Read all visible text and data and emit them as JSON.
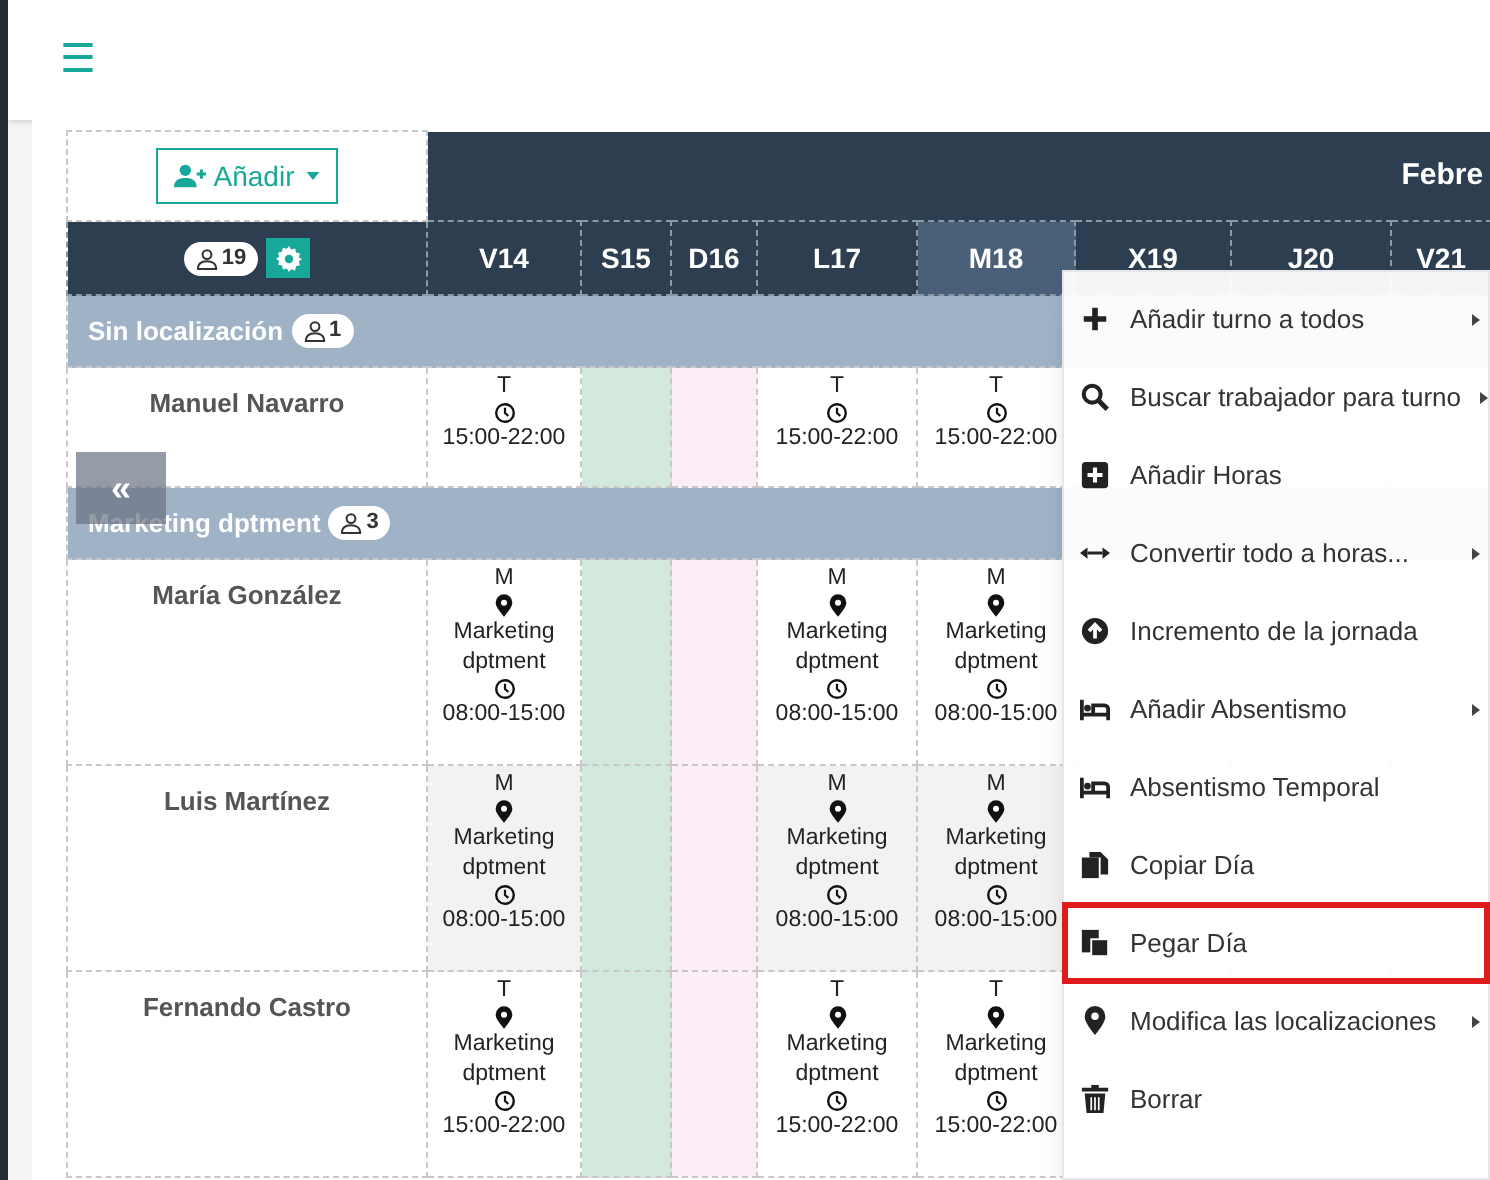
{
  "toolbar": {
    "menu_icon": "☰"
  },
  "planner": {
    "add_button": "Añadir",
    "month": "Febre",
    "staff_count": "19",
    "days": [
      {
        "label": "V14",
        "kind": "weekday",
        "selected": false
      },
      {
        "label": "S15",
        "kind": "saturday",
        "selected": false
      },
      {
        "label": "D16",
        "kind": "sunday",
        "selected": false
      },
      {
        "label": "L17",
        "kind": "weekday",
        "selected": false
      },
      {
        "label": "M18",
        "kind": "weekday",
        "selected": true
      },
      {
        "label": "X19",
        "kind": "weekday",
        "selected": false
      },
      {
        "label": "J20",
        "kind": "weekday",
        "selected": false
      },
      {
        "label": "V21",
        "kind": "weekday",
        "selected": false
      }
    ],
    "groups": [
      {
        "name": "Sin localización",
        "count": "1",
        "employees": [
          {
            "name": "Manuel Navarro",
            "shaded": false,
            "shifts": [
              {
                "kind": "shift",
                "code": "T",
                "time": "15:00-22:00"
              },
              {
                "kind": "empty"
              },
              {
                "kind": "empty"
              },
              {
                "kind": "shift",
                "code": "T",
                "time": "15:00-22:00"
              },
              {
                "kind": "shift",
                "code": "T",
                "time": "15:00-22:00"
              }
            ]
          }
        ]
      },
      {
        "name": "Marketing dptment",
        "count": "3",
        "employees": [
          {
            "name": "María González",
            "shaded": false,
            "shifts": [
              {
                "kind": "shift",
                "code": "M",
                "location": "Marketing dptment",
                "time": "08:00-15:00"
              },
              {
                "kind": "empty"
              },
              {
                "kind": "empty"
              },
              {
                "kind": "shift",
                "code": "M",
                "location": "Marketing dptment",
                "time": "08:00-15:00"
              },
              {
                "kind": "shift",
                "code": "M",
                "location": "Marketing dptment",
                "time": "08:00-15:00"
              }
            ]
          },
          {
            "name": "Luis Martínez",
            "shaded": true,
            "shifts": [
              {
                "kind": "shift",
                "code": "M",
                "location": "Marketing dptment",
                "time": "08:00-15:00"
              },
              {
                "kind": "empty"
              },
              {
                "kind": "empty"
              },
              {
                "kind": "shift",
                "code": "M",
                "location": "Marketing dptment",
                "time": "08:00-15:00"
              },
              {
                "kind": "shift",
                "code": "M",
                "location": "Marketing dptment",
                "time": "08:00-15:00"
              }
            ]
          },
          {
            "name": "Fernando Castro",
            "shaded": false,
            "shifts": [
              {
                "kind": "shift",
                "code": "T",
                "location": "Marketing dptment",
                "time": "15:00-22:00"
              },
              {
                "kind": "empty"
              },
              {
                "kind": "empty"
              },
              {
                "kind": "shift",
                "code": "T",
                "location": "Marketing dptment",
                "time": "15:00-22:00"
              },
              {
                "kind": "shift",
                "code": "T",
                "location": "Marketing dptment",
                "time": "15:00-22:00"
              }
            ]
          }
        ]
      }
    ],
    "collapse_button": "«"
  },
  "context_menu": {
    "items": [
      {
        "label": "Añadir turno a todos",
        "kind": "plus",
        "submenu": true,
        "highlighted": false
      },
      {
        "label": "Buscar trabajador para turno",
        "kind": "search",
        "submenu": true,
        "highlighted": false
      },
      {
        "label": "Añadir Horas",
        "kind": "plus-square",
        "submenu": false,
        "highlighted": false
      },
      {
        "label": "Convertir todo a horas...",
        "kind": "arrows",
        "submenu": true,
        "highlighted": false
      },
      {
        "label": "Incremento de la jornada",
        "kind": "up-circle",
        "submenu": false,
        "highlighted": false
      },
      {
        "label": "Añadir Absentismo",
        "kind": "bed",
        "submenu": true,
        "highlighted": false
      },
      {
        "label": "Absentismo Temporal",
        "kind": "bed",
        "submenu": false,
        "highlighted": false
      },
      {
        "label": "Copiar Día",
        "kind": "copy",
        "submenu": false,
        "highlighted": false
      },
      {
        "label": "Pegar Día",
        "kind": "paste",
        "submenu": false,
        "highlighted": true
      },
      {
        "label": "Modifica las localizaciones",
        "kind": "pin",
        "submenu": true,
        "highlighted": false
      },
      {
        "label": "Borrar",
        "kind": "trash",
        "submenu": false,
        "highlighted": false
      }
    ]
  }
}
